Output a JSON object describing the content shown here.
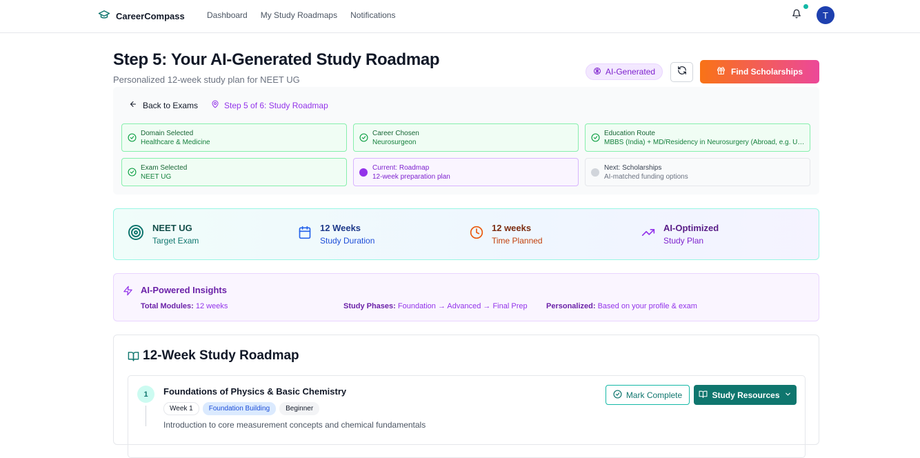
{
  "nav": {
    "brand": "CareerCompass",
    "links": [
      "Dashboard",
      "My Study Roadmaps",
      "Notifications"
    ],
    "avatar_initial": "T",
    "icons": {
      "brand": "graduation-cap-icon",
      "bell": "bell-icon"
    }
  },
  "header": {
    "title": "Step 5: Your AI-Generated Study Roadmap",
    "subtitle": "Personalized 12-week study plan for NEET UG",
    "ai_badge": "AI-Generated",
    "scholarships_button": "Find Scholarships"
  },
  "progress": {
    "back_label": "Back to Exams",
    "step_indicator": "Step 5 of 6: Study Roadmap",
    "cards": [
      {
        "title": "Domain Selected",
        "value": "Healthcare & Medicine",
        "state": "done"
      },
      {
        "title": "Career Chosen",
        "value": "Neurosurgeon",
        "state": "done"
      },
      {
        "title": "Education Route",
        "value": "MBBS (India) + MD/Residency in Neurosurgery (Abroad, e.g. USA/UK)",
        "state": "done"
      },
      {
        "title": "Exam Selected",
        "value": "NEET UG",
        "state": "done"
      },
      {
        "title": "Current: Roadmap",
        "value": "12-week preparation plan",
        "state": "current"
      },
      {
        "title": "Next: Scholarships",
        "value": "AI-matched funding options",
        "state": "next"
      }
    ]
  },
  "stats": [
    {
      "value": "NEET UG",
      "label": "Target Exam",
      "icon": "target-icon",
      "color": "#0f766e"
    },
    {
      "value": "12 Weeks",
      "label": "Study Duration",
      "icon": "calendar-icon",
      "color": "#1d4ed8"
    },
    {
      "value": "12 weeks",
      "label": "Time Planned",
      "icon": "clock-icon",
      "color": "#c2410c"
    },
    {
      "value": "AI-Optimized",
      "label": "Study Plan",
      "icon": "trending-up-icon",
      "color": "#7e22ce"
    }
  ],
  "insights": {
    "title": "AI-Powered Insights",
    "total_modules_label": "Total Modules:",
    "total_modules_value": "12 weeks",
    "phases_label": "Study Phases:",
    "phases_value": "Foundation → Advanced → Final Prep",
    "personalized_label": "Personalized:",
    "personalized_value": "Based on your profile & exam"
  },
  "roadmap": {
    "title": "12-Week Study Roadmap",
    "modules": [
      {
        "number": "1",
        "title": "Foundations of Physics & Basic Chemistry",
        "tags": [
          "Week 1",
          "Foundation Building",
          "Beginner"
        ],
        "description": "Introduction to core measurement concepts and chemical fundamentals",
        "mark_complete": "Mark Complete",
        "resources": "Study Resources"
      }
    ]
  },
  "colors": {
    "teal": "#0f766e",
    "purple": "#7e22ce",
    "green": "#16a34a",
    "orange": "#f97316",
    "pink": "#ec4899"
  }
}
